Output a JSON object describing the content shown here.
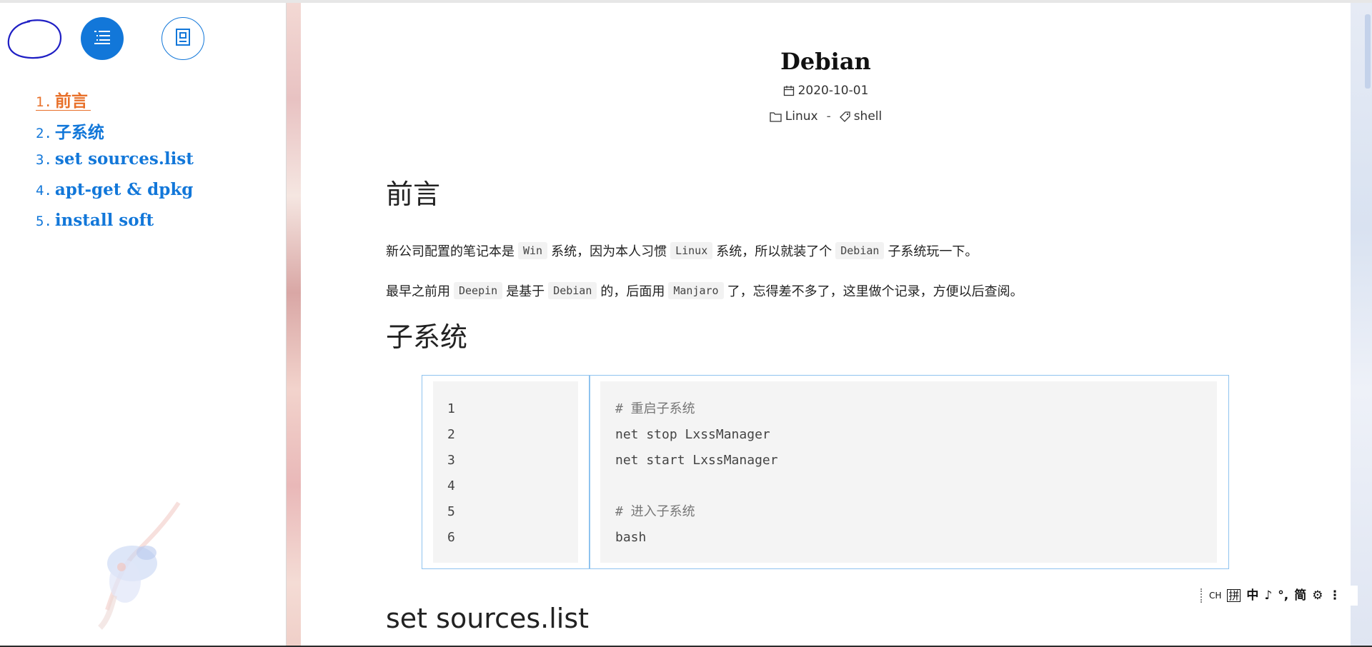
{
  "sidebar": {
    "buttons": {
      "toc_icon": "list-icon",
      "overview_icon": "profile-icon"
    },
    "toc": [
      {
        "num": "1.",
        "label": "前言",
        "active": true
      },
      {
        "num": "2.",
        "label": "子系统",
        "active": false
      },
      {
        "num": "3.",
        "label": "set sources.list",
        "active": false
      },
      {
        "num": "4.",
        "label": "apt-get & dpkg",
        "active": false
      },
      {
        "num": "5.",
        "label": "install soft",
        "active": false
      }
    ]
  },
  "post": {
    "title": "Debian",
    "date": "2020-10-01",
    "category": "Linux",
    "separator": "-",
    "tag": "shell",
    "sections": {
      "intro": {
        "heading": "前言",
        "para1": {
          "t1": "新公司配置的笔记本是",
          "c1": "Win",
          "t2": "系统，因为本人习惯",
          "c2": "Linux",
          "t3": "系统，所以就装了个",
          "c3": "Debian",
          "t4": "子系统玩一下。"
        },
        "para2": {
          "t1": "最早之前用",
          "c1": "Deepin",
          "t2": "是基于",
          "c2": "Debian",
          "t3": "的，后面用",
          "c3": "Manjaro",
          "t4": "了，忘得差不多了，这里做个记录，方便以后查阅。"
        }
      },
      "subsystem": {
        "heading": "子系统",
        "code": {
          "line_numbers": [
            "1",
            "2",
            "3",
            "4",
            "5",
            "6"
          ],
          "lines": [
            "# 重启子系统",
            "net stop LxssManager",
            "net start LxssManager",
            "",
            "# 进入子系统",
            "bash"
          ]
        }
      },
      "sources": {
        "heading": "set sources.list"
      }
    }
  },
  "ime": {
    "items": [
      "CH",
      "拼",
      "中",
      "♪",
      "°,",
      "简",
      "⚙",
      "⋮"
    ]
  },
  "colors": {
    "accent": "#1277d9",
    "active": "#e8702a",
    "annotation": "#1f1fc4",
    "code_border": "#8fc3ef",
    "code_bg": "#f4f4f4"
  }
}
